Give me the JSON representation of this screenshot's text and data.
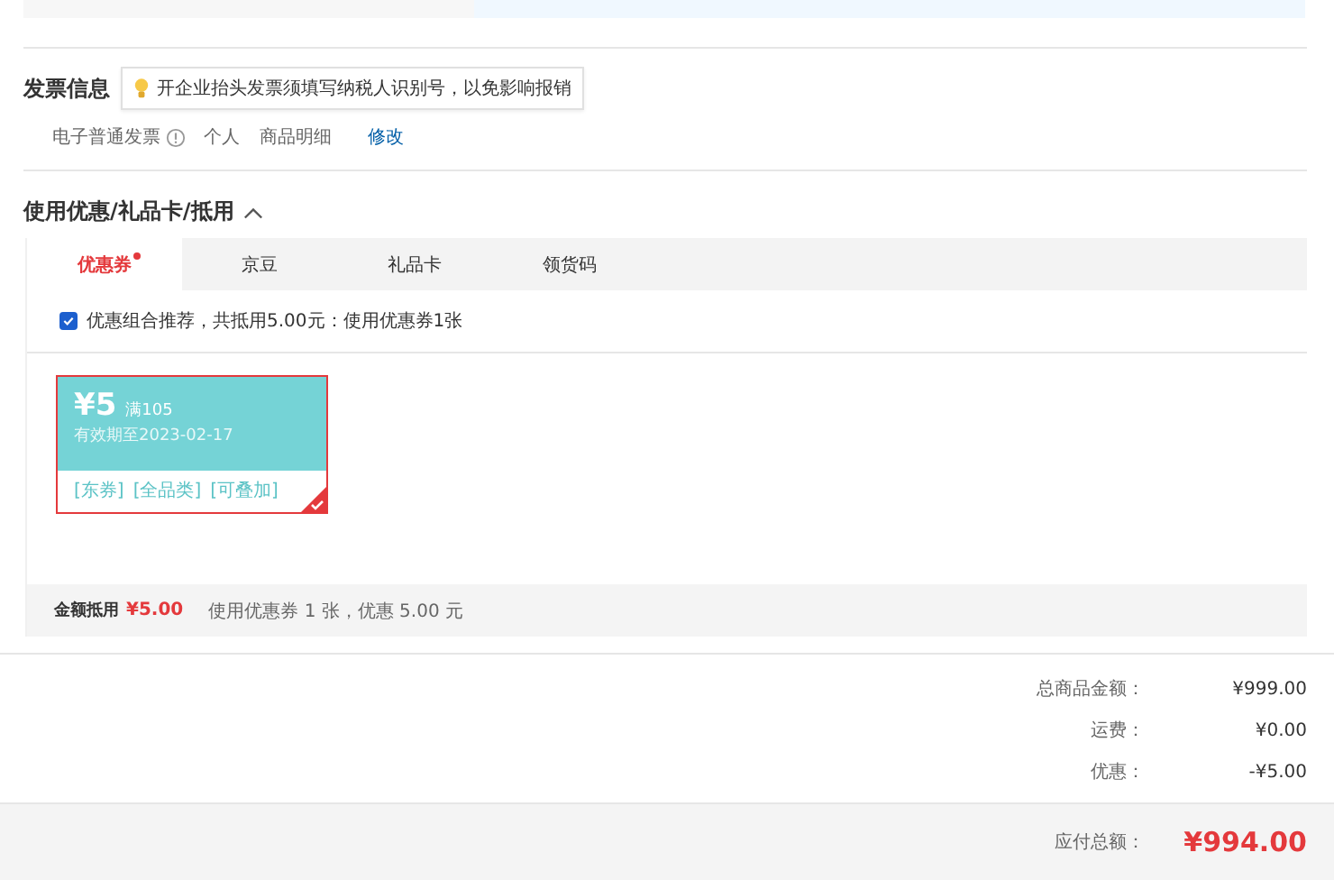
{
  "invoice": {
    "title": "发票信息",
    "tip": "开企业抬头发票须填写纳税人识别号，以免影响报销",
    "type": "电子普通发票",
    "details": [
      "个人",
      "商品明细"
    ],
    "edit_link": "修改"
  },
  "discounts": {
    "title": "使用优惠/礼品卡/抵用",
    "expanded": true,
    "tabs": [
      {
        "label": "优惠券",
        "selected": true,
        "dot": true
      },
      {
        "label": "京豆",
        "selected": false,
        "dot": false
      },
      {
        "label": "礼品卡",
        "selected": false,
        "dot": false
      },
      {
        "label": "领货码",
        "selected": false,
        "dot": false
      }
    ],
    "recommend": {
      "checked": true,
      "text": "优惠组合推荐，共抵用5.00元：使用优惠券1张"
    },
    "coupons": [
      {
        "amount": "¥5",
        "condition": "满105",
        "validity": "有效期至2023-02-17",
        "tags": [
          "[东券]",
          "[全品类]",
          "[可叠加]"
        ],
        "selected": true
      }
    ],
    "summary": {
      "label": "金额抵用",
      "amount": "¥5.00",
      "detail": "使用优惠券 1 张，优惠 5.00 元"
    }
  },
  "totals": [
    {
      "label": "总商品金额：",
      "value": "¥999.00"
    },
    {
      "label": "运费：",
      "value": "¥0.00"
    },
    {
      "label": "优惠：",
      "value": "-¥5.00"
    }
  ],
  "payable": {
    "label": "应付总额：",
    "value": "¥994.00"
  }
}
